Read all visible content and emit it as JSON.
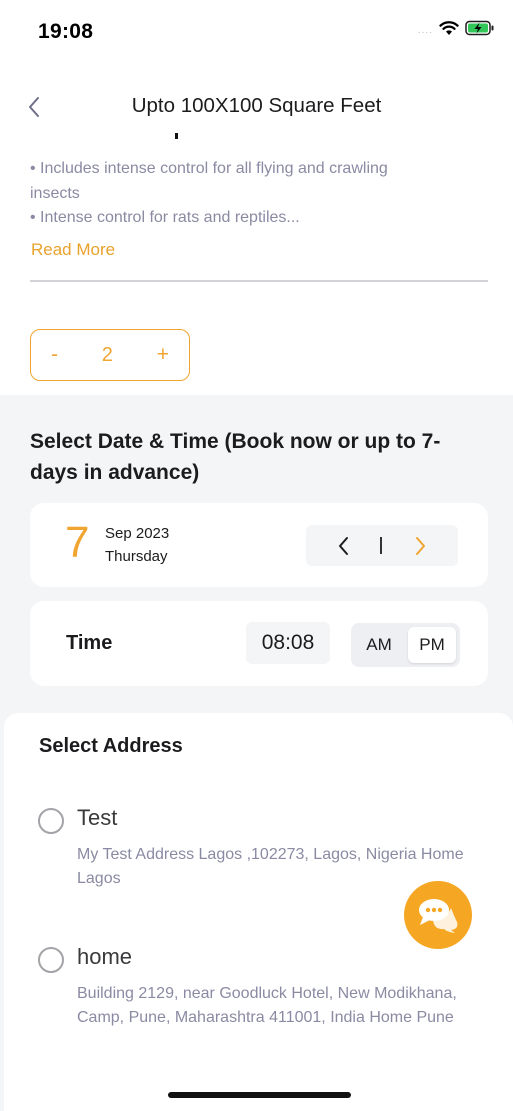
{
  "status_bar": {
    "time": "19:08",
    "signal": "....",
    "icons": [
      "wifi-icon",
      "battery-charging-icon"
    ]
  },
  "header": {
    "title": "Upto 100X100 Square Feet",
    "back_icon": "chevron-left-icon"
  },
  "description": {
    "line1": "• Includes intense control for all flying and crawling insects",
    "line2": "• Intense control for rats and reptiles...",
    "read_more": "Read More"
  },
  "quantity": {
    "minus": "-",
    "value": "2",
    "plus": "+"
  },
  "schedule": {
    "title": "Select Date & Time (Book now or up to 7-days in advance)",
    "date": {
      "day_number": "7",
      "month_year": "Sep 2023",
      "weekday": "Thursday"
    },
    "time": {
      "label": "Time",
      "value": "08:08",
      "am": "AM",
      "pm": "PM",
      "selected": "PM"
    }
  },
  "address": {
    "title": "Select Address",
    "items": [
      {
        "name": "Test",
        "details": "My Test Address Lagos ,102273, Lagos, Nigeria Home Lagos"
      },
      {
        "name": "home",
        "details": "Building 2129, near Goodluck Hotel, New Modikhana, Camp, Pune, Maharashtra 411001, India Home Pune"
      }
    ]
  },
  "colors": {
    "accent": "#f0a531",
    "fab": "#f5a623",
    "muted_text": "#8a8aa3",
    "section_bg": "#f4f5f7"
  }
}
